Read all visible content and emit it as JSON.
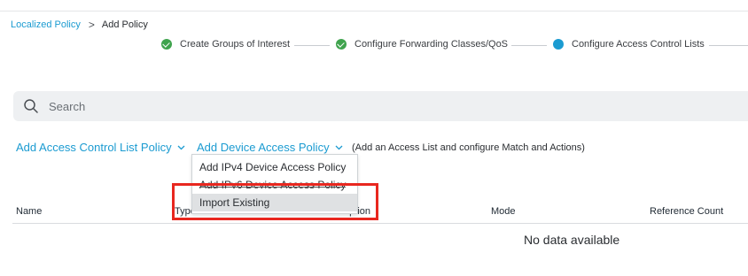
{
  "breadcrumb": {
    "parent": "Localized Policy",
    "separator": ">",
    "current": "Add Policy"
  },
  "steps": [
    {
      "label": "Create Groups of Interest",
      "status": "done"
    },
    {
      "label": "Configure Forwarding Classes/QoS",
      "status": "done"
    },
    {
      "label": "Configure Access Control Lists",
      "status": "active"
    }
  ],
  "search": {
    "placeholder": "Search",
    "value": ""
  },
  "actions": {
    "add_acl_policy": "Add Access Control List Policy",
    "add_device_access_policy": "Add Device Access Policy",
    "hint": "(Add an Access List and configure Match and Actions)"
  },
  "dropdown": {
    "items": [
      {
        "label": "Add IPv4 Device Access Policy"
      },
      {
        "label": "Add IPv6 Device Access Policy"
      },
      {
        "label": "Import Existing"
      }
    ]
  },
  "table": {
    "columns": [
      "Name",
      "Type",
      "Description",
      "Mode",
      "Reference Count"
    ],
    "empty_text": "No data available"
  },
  "colors": {
    "accent": "#1b9bd1",
    "done": "#3fa34d",
    "highlight": "#e8271f"
  }
}
